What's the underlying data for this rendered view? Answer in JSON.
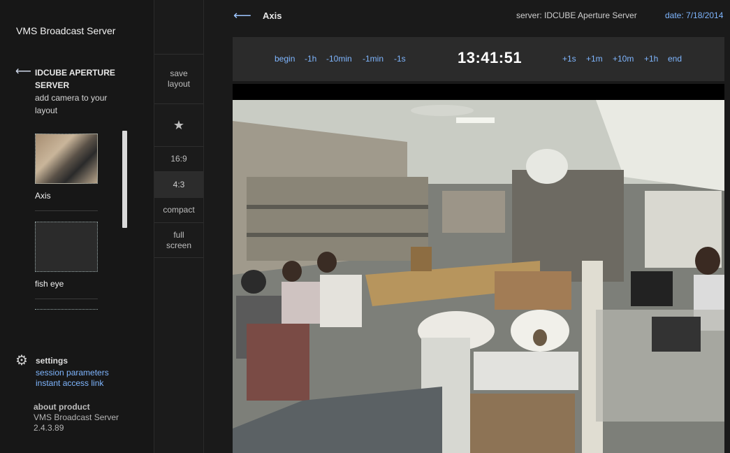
{
  "app": {
    "title": "VMS Broadcast Server"
  },
  "sidebar": {
    "back_icon": "left-arrow-icon",
    "server_name": "IDCUBE APERTURE SERVER",
    "add_hint": "add camera to your layout",
    "cameras": [
      {
        "label": "Axis"
      },
      {
        "label": "fish eye"
      }
    ],
    "settings": {
      "icon": "gear-icon",
      "label": "settings",
      "session_link": "session parameters",
      "instant_link": "instant access link"
    },
    "about": {
      "title": "about product",
      "product": "VMS Broadcast Server",
      "version": "2.4.3.89"
    }
  },
  "toolbar": {
    "save_layout": "save layout",
    "favorite_icon": "star-icon",
    "ratio_16_9": "16:9",
    "ratio_4_3": "4:3",
    "compact": "compact",
    "full_screen": "full screen",
    "active": "4:3"
  },
  "main": {
    "back_icon": "left-arrow-icon",
    "camera_title": "Axis",
    "server_text": "server: IDCUBE Aperture Server",
    "date_text": "date: 7/18/2014",
    "time": "13:41:51",
    "seek_back": [
      "begin",
      "-1h",
      "-10min",
      "-1min",
      "-1s"
    ],
    "seek_forward": [
      "+1s",
      "+1m",
      "+10m",
      "+1h",
      "end"
    ]
  },
  "colors": {
    "accent": "#7fb6ff",
    "background": "#141414",
    "panel": "#2b2b2b"
  }
}
